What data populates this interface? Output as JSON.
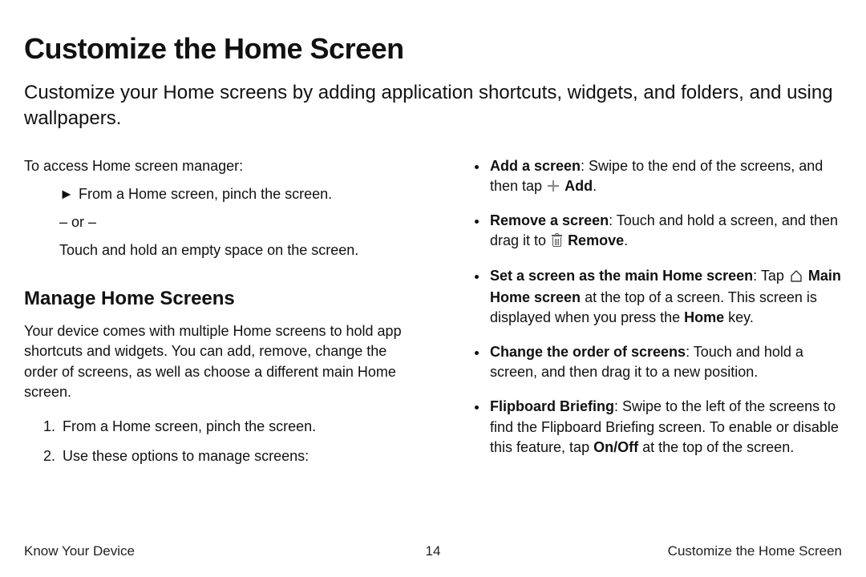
{
  "title": "Customize the Home Screen",
  "intro": "Customize your Home screens by adding application shortcuts, widgets, and folders, and using wallpapers.",
  "access_lead": "To access Home screen manager:",
  "access_step": "From a Home screen, pinch the screen.",
  "or_label": "– or –",
  "access_alt": "Touch and hold an empty space on the screen.",
  "section2_heading": "Manage Home Screens",
  "section2_intro": "Your device comes with multiple Home screens to hold app shortcuts and widgets. You can add, remove, change the order of screens, as well as choose a different main Home screen.",
  "ol": {
    "s1": "From a Home screen, pinch the screen.",
    "s2": "Use these options to manage screens:"
  },
  "bullets": {
    "b1": {
      "label": "Add a screen",
      "pre": ": Swipe to the end of the screens, and then tap ",
      "icon_label": "Add",
      "post": "."
    },
    "b2": {
      "label": "Remove a screen",
      "pre": ": Touch and hold a screen, and then drag it to ",
      "icon_label": "Remove",
      "post": "."
    },
    "b3": {
      "label": "Set a screen as the main Home screen",
      "pre": ": Tap ",
      "icon_label": "Main Home screen",
      "mid": " at the top of a screen. This screen is displayed when you press the ",
      "key": "Home",
      "post": " key."
    },
    "b4": {
      "label": "Change the order of screens",
      "text": ": Touch and hold a screen, and then drag it to a new position."
    },
    "b5": {
      "label": "Flipboard Briefing",
      "pre": ": Swipe to the left of the screens to find the Flipboard Briefing screen. To enable or disable this feature, tap ",
      "key": "On/Off",
      "post": " at the top of the screen."
    }
  },
  "footer": {
    "left": "Know Your Device",
    "center": "14",
    "right": "Customize the Home Screen"
  }
}
